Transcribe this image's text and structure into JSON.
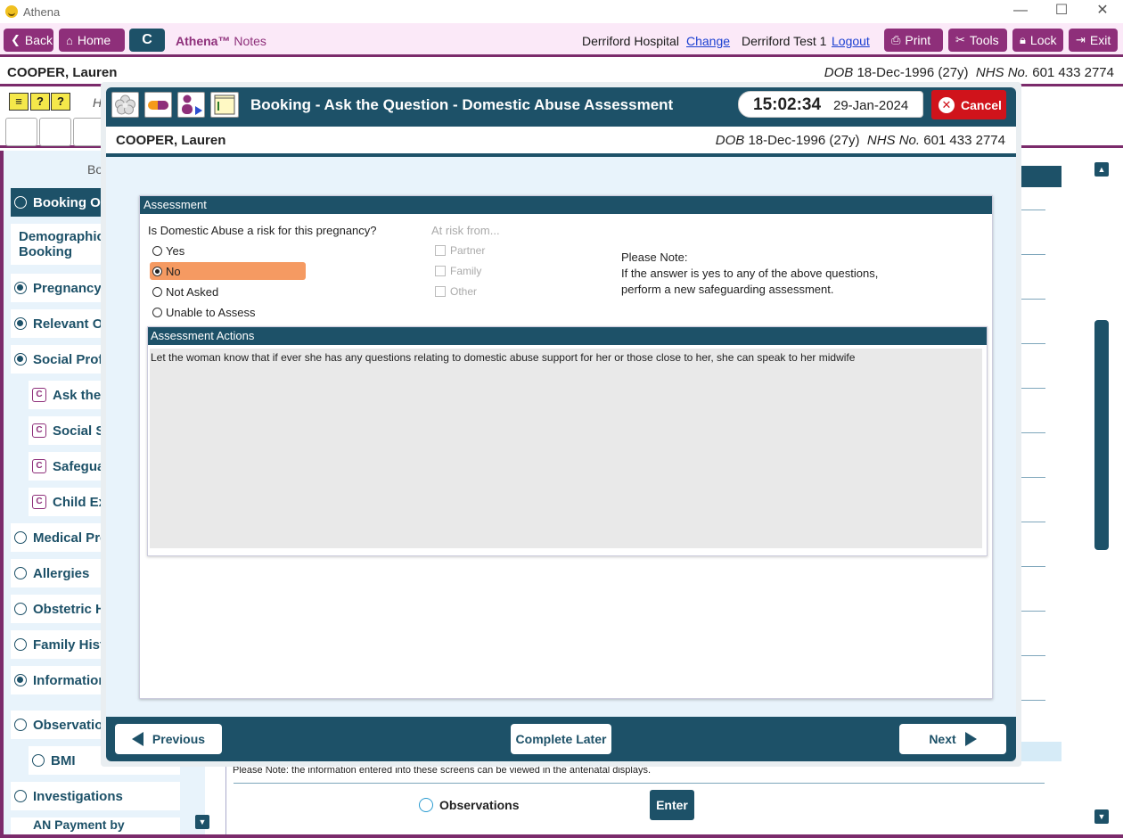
{
  "window": {
    "title": "Athena",
    "minimize": "—",
    "maximize": "☐",
    "close": "✕"
  },
  "toolbar": {
    "back": "Back",
    "home": "Home",
    "c": "C",
    "brand": "Athena™",
    "brand_suffix": "Notes",
    "hospital": "Derriford Hospital",
    "change": "Change",
    "user": "Derriford Test 1",
    "logout": "Logout",
    "print": "Print",
    "tools": "Tools",
    "lock": "Lock",
    "exit": "Exit"
  },
  "patient": {
    "name": "COOPER, Lauren",
    "dob_label": "DOB",
    "dob": "18-Dec-1996 (27y)",
    "nhs_label": "NHS No.",
    "nhs": "601 433 2774"
  },
  "background": {
    "h_letter": "H",
    "sidebar_heading": "Bo",
    "sidebar": [
      {
        "label": "Booking Ov",
        "type": "radio",
        "active": true
      },
      {
        "label": "Demographics",
        "label2": "Booking",
        "type": "plain"
      },
      {
        "label": "Pregnancy I",
        "type": "radio-filled"
      },
      {
        "label": "Relevant Ot",
        "type": "radio-filled"
      },
      {
        "label": "Social Profil",
        "type": "radio-filled"
      },
      {
        "label": "Ask the",
        "type": "c"
      },
      {
        "label": "Social Se",
        "type": "c"
      },
      {
        "label": "Safegua",
        "type": "c"
      },
      {
        "label": "Child Exp",
        "type": "c"
      },
      {
        "label": "Medical Pro",
        "type": "radio"
      },
      {
        "label": "Allergies",
        "type": "radio"
      },
      {
        "label": "Obstetric H",
        "type": "radio"
      },
      {
        "label": "Family Histo",
        "type": "radio"
      },
      {
        "label": "Information",
        "type": "radio-filled"
      },
      {
        "label": "Observation",
        "type": "radio"
      },
      {
        "label": "BMI",
        "type": "radio"
      },
      {
        "label": "Investigations",
        "type": "radio"
      },
      {
        "label": "AN Payment by",
        "type": "plain"
      }
    ],
    "bottom_note": "Please Note: the information entered into these screens can be viewed in the antenatal displays.",
    "observations": "Observations",
    "enter": "Enter"
  },
  "modal": {
    "title": "Booking - Ask the Question - Domestic Abuse Assessment",
    "time": "15:02:34",
    "date": "29-Jan-2024",
    "cancel": "Cancel",
    "assessment_header": "Assessment",
    "question": "Is Domestic Abuse a risk for this pregnancy?",
    "options": [
      {
        "label": "Yes",
        "selected": false
      },
      {
        "label": "No",
        "selected": true
      },
      {
        "label": "Not Asked",
        "selected": false
      },
      {
        "label": "Unable to Assess",
        "selected": false
      }
    ],
    "at_risk_from": "At risk from...",
    "risk_options": [
      "Partner",
      "Family",
      "Other"
    ],
    "note_title": "Please Note:",
    "note_line1": "If the answer is yes to any of the above questions,",
    "note_line2": "perform a new safeguarding assessment.",
    "actions_header": "Assessment Actions",
    "actions_text": "Let the woman know that if ever she has any questions relating to domestic abuse support for her or those close to her, she can speak to her midwife",
    "previous": "Previous",
    "complete_later": "Complete Later",
    "next": "Next"
  },
  "colors": {
    "primary": "#1d5168",
    "accent": "#8e2f7a",
    "selected": "#f59a62",
    "cancel": "#d0131b"
  }
}
